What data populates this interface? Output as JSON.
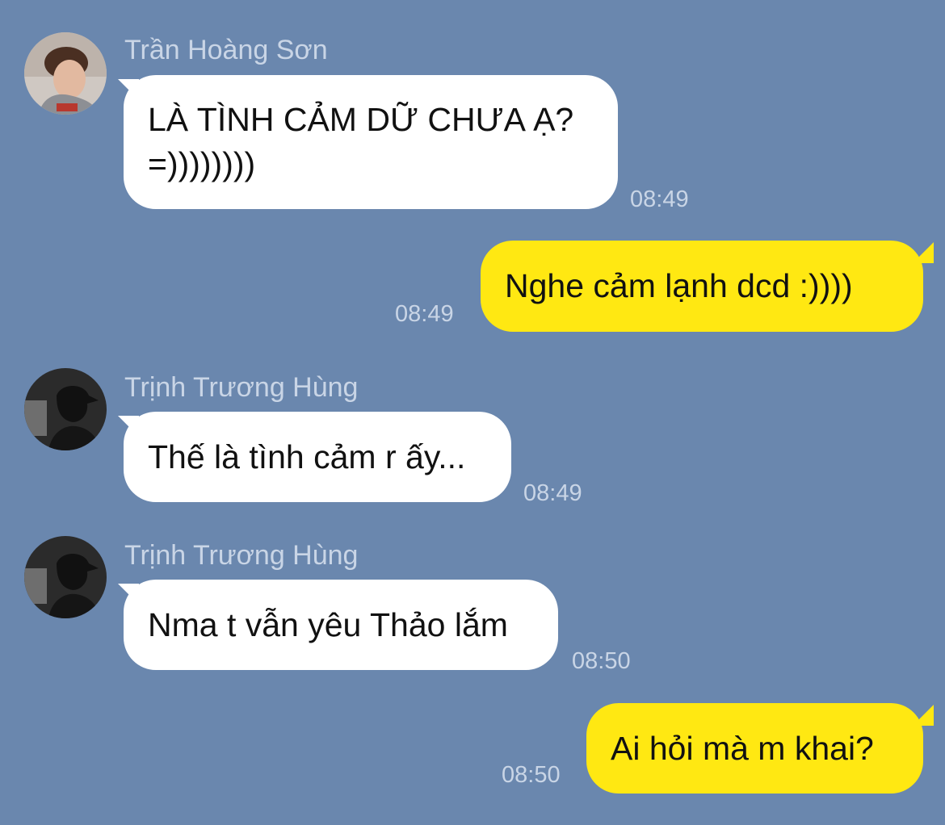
{
  "messages": [
    {
      "direction": "in",
      "sender": "Trần Hoàng Sơn",
      "text": "LÀ TÌNH CẢM DỮ CHƯA Ạ?\n=))))))))",
      "time": "08:49",
      "avatar": "user-avatar-photo"
    },
    {
      "direction": "out",
      "text": "Nghe cảm lạnh dcd :))))",
      "time": "08:49"
    },
    {
      "direction": "in",
      "sender": "Trịnh Trương Hùng",
      "text": "Thế là tình cảm r ấy...",
      "time": "08:49",
      "avatar": "user-avatar-dark"
    },
    {
      "direction": "in",
      "sender": "Trịnh Trương Hùng",
      "text": "Nma t vẫn yêu Thảo lắm",
      "time": "08:50",
      "avatar": "user-avatar-dark"
    },
    {
      "direction": "out",
      "text": "Ai hỏi mà m khai?",
      "time": "08:50"
    }
  ],
  "colors": {
    "background": "#6a87ae",
    "incoming_bubble": "#ffffff",
    "outgoing_bubble": "#ffe812",
    "meta_text": "#c9d5e6"
  }
}
